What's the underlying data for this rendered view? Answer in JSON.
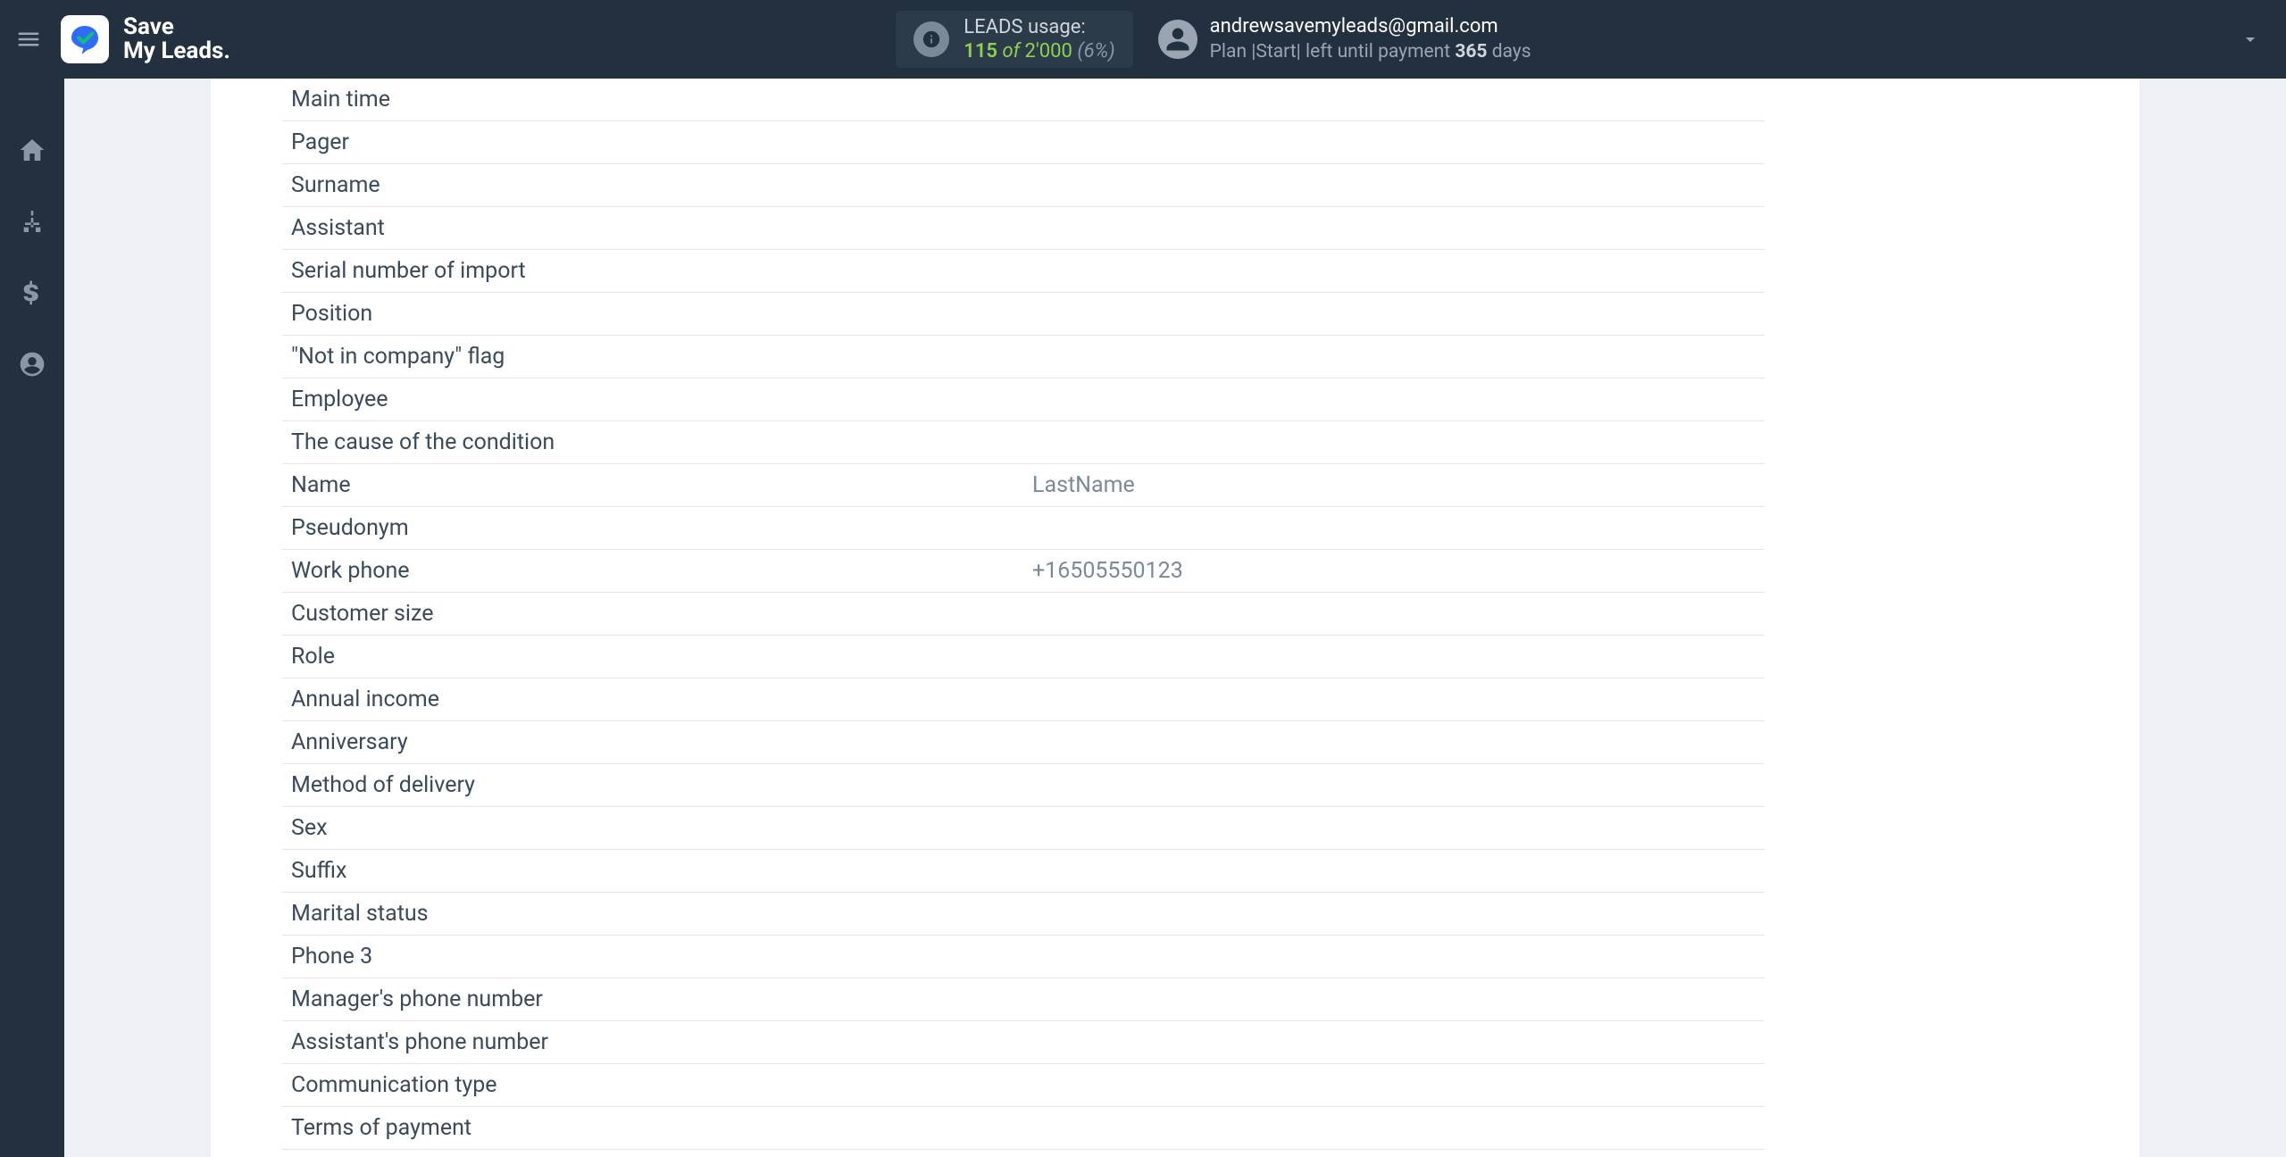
{
  "header": {
    "logo_line1": "Save",
    "logo_line2": "My Leads.",
    "usage_label": "LEADS usage:",
    "usage_current": "115",
    "usage_of": "of",
    "usage_total": "2'000",
    "usage_pct": "(6%)",
    "user_email": "andrewsavemyleads@gmail.com",
    "plan_prefix": "Plan |Start| left until payment",
    "plan_days_number": "365",
    "plan_days_suffix": "days"
  },
  "rows": [
    {
      "label": "Main time",
      "value": ""
    },
    {
      "label": "Pager",
      "value": ""
    },
    {
      "label": "Surname",
      "value": ""
    },
    {
      "label": "Assistant",
      "value": ""
    },
    {
      "label": "Serial number of import",
      "value": ""
    },
    {
      "label": "Position",
      "value": ""
    },
    {
      "label": "\"Not in company\" flag",
      "value": ""
    },
    {
      "label": "Employee",
      "value": ""
    },
    {
      "label": "The cause of the condition",
      "value": ""
    },
    {
      "label": "Name",
      "value": "LastName"
    },
    {
      "label": "Pseudonym",
      "value": ""
    },
    {
      "label": "Work phone",
      "value": "+16505550123"
    },
    {
      "label": "Customer size",
      "value": ""
    },
    {
      "label": "Role",
      "value": ""
    },
    {
      "label": "Annual income",
      "value": ""
    },
    {
      "label": "Anniversary",
      "value": ""
    },
    {
      "label": "Method of delivery",
      "value": ""
    },
    {
      "label": "Sex",
      "value": ""
    },
    {
      "label": "Suffix",
      "value": ""
    },
    {
      "label": "Marital status",
      "value": ""
    },
    {
      "label": "Phone 3",
      "value": ""
    },
    {
      "label": "Manager's phone number",
      "value": ""
    },
    {
      "label": "Assistant's phone number",
      "value": ""
    },
    {
      "label": "Communication type",
      "value": ""
    },
    {
      "label": "Terms of payment",
      "value": ""
    }
  ]
}
